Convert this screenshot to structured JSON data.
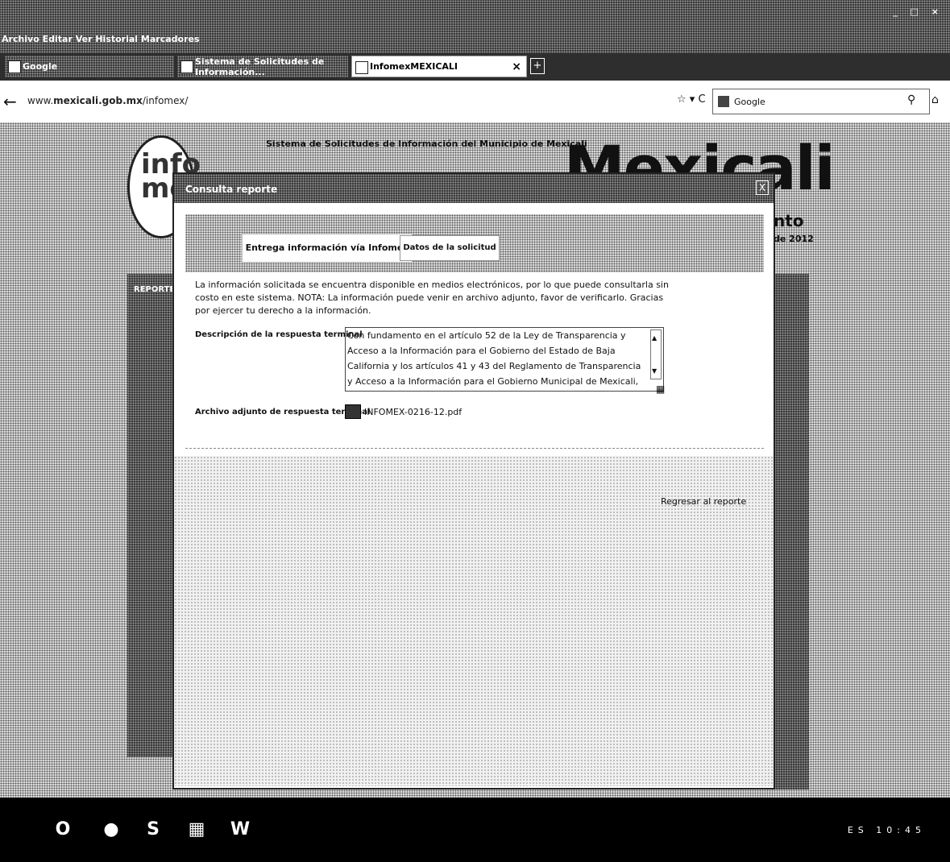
{
  "browser": {
    "menu_row": "Archivo  Editar  Ver  Historial  Marcadores",
    "window_controls": "_ □ ×",
    "tabs": [
      {
        "label": "Google"
      },
      {
        "label": "Sistema de Solicitudes de Información..."
      },
      {
        "label": "InfomexMEXICALI"
      }
    ],
    "new_tab": "+",
    "url_prefix": "www.",
    "url_host": "mexicali.gob.mx",
    "url_path": "/infomex/",
    "search_placeholder": "Google"
  },
  "page": {
    "logo_text": "info mex",
    "site_title": "Sistema de Solicitudes de Información del Municipio de Mexicali",
    "brand": "Mexicali",
    "brand_sub1": "nto",
    "brand_sub2": "de 2012",
    "left_nav_header": "REPORTE"
  },
  "modal": {
    "title": "Consulta reporte",
    "close": "X",
    "tabs": [
      {
        "label": "Entrega información vía Infomex"
      },
      {
        "label": "Datos de la solicitud"
      }
    ],
    "notice": "La información solicitada se encuentra disponible en medios electrónicos, por lo que puede consultarla sin costo en este sistema. NOTA: La información puede venir en archivo adjunto, favor de verificarlo. Gracias por ejercer tu derecho a la información.",
    "description_label": "Descripción de la respuesta terminal",
    "description_text": "Con fundamento en el artículo 52 de la Ley de Transparencia y Acceso a la Información para el Gobierno del Estado de Baja California y los artículos 41 y 43 del Reglamento de Transparencia y Acceso a la Información para el Gobierno Municipal de Mexicali, Baja California, le comento que la",
    "attachment_label": "Archivo adjunto de respuesta terminal",
    "attachment_file": "INFOMEX-0216-12.pdf",
    "back_link": "Regresar al reporte"
  },
  "taskbar": {
    "items": [
      "Outlook",
      "Chrome",
      "Skype",
      "Calculator",
      "Word"
    ],
    "tray": "ES 10:45"
  }
}
